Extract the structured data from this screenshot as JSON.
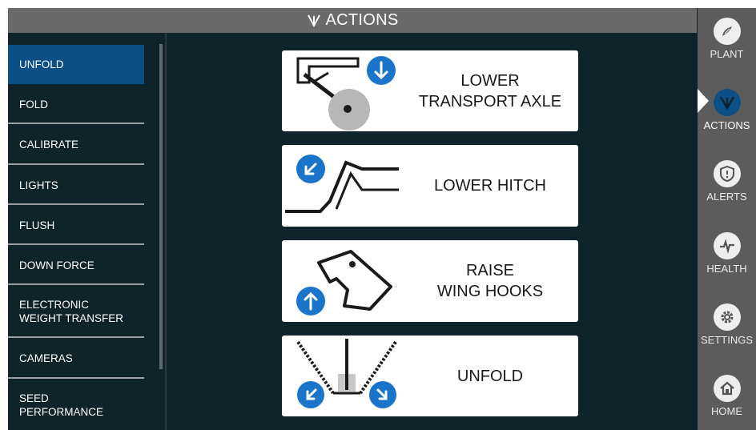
{
  "header": {
    "title": "ACTIONS",
    "icon": "actions-icon"
  },
  "menu": {
    "items": [
      {
        "label": "UNFOLD",
        "active": true
      },
      {
        "label": "FOLD"
      },
      {
        "label": "CALIBRATE"
      },
      {
        "label": "LIGHTS"
      },
      {
        "label": "FLUSH"
      },
      {
        "label": "DOWN FORCE"
      },
      {
        "label": "ELECTRONIC",
        "label2": "WEIGHT TRANSFER"
      },
      {
        "label": "CAMERAS"
      },
      {
        "label": "SEED",
        "label2": "PERFORMANCE"
      }
    ]
  },
  "actions": [
    {
      "line1": "LOWER",
      "line2": "TRANSPORT AXLE",
      "icon": "transport-axle-icon"
    },
    {
      "line1": "LOWER HITCH",
      "line2": "",
      "icon": "hitch-icon"
    },
    {
      "line1": "RAISE",
      "line2": "WING HOOKS",
      "icon": "wing-hooks-icon"
    },
    {
      "line1": "UNFOLD",
      "line2": "",
      "icon": "unfold-icon"
    }
  ],
  "nav": {
    "items": [
      {
        "label": "PLANT",
        "icon": "plant-icon"
      },
      {
        "label": "ACTIONS",
        "icon": "actions-icon",
        "active": true
      },
      {
        "label": "ALERTS",
        "icon": "alert-shield-icon"
      },
      {
        "label": "HEALTH",
        "icon": "health-pulse-icon"
      },
      {
        "label": "SETTINGS",
        "icon": "gear-icon"
      },
      {
        "label": "HOME",
        "icon": "home-icon"
      }
    ]
  },
  "colors": {
    "accent": "#0a4f86",
    "panel": "#0f232a",
    "nav_bg": "#5c5c5c",
    "header_bg": "#6a6a6a",
    "icon_blue": "#1a74c9"
  }
}
